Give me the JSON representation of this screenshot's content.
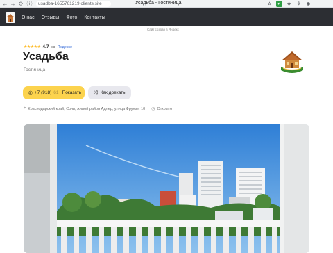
{
  "browser": {
    "url": "usadba-1655761219.clients.site",
    "tab_title": "Усадьба - Гостиница"
  },
  "nav": {
    "items": [
      "О нас",
      "Отзывы",
      "Фото",
      "Контакты"
    ]
  },
  "made_with": "Сайт создан в Яндекс",
  "business": {
    "rating_value": "4.7",
    "rating_on": "на",
    "rating_source": "Яндексе",
    "rating_stars": 5,
    "title": "Усадьба",
    "category": "Гостиница"
  },
  "actions": {
    "phone_number": "+7 (918)",
    "phone_mask": "61",
    "phone_show": "Показать",
    "route_label": "Как доехать"
  },
  "info": {
    "address": "Краснодарский край, Сочи, жилой район Адлер, улица Фрунзе, 10",
    "status": "Открыто"
  },
  "colors": {
    "accent_yellow": "#fcd34d",
    "star": "#fdb81e",
    "nav_bg": "#2c2e33",
    "link_blue": "#2a62d6"
  },
  "icons": {
    "phone": "phone-icon",
    "route": "route-icon",
    "pin": "location-pin-icon",
    "clock": "clock-icon"
  }
}
